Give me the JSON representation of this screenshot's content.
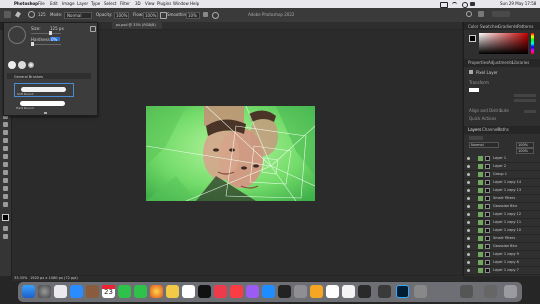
{
  "menu_bar": {
    "app_name": "Photoshop",
    "items": [
      "File",
      "Edit",
      "Image",
      "Layer",
      "Type",
      "Select",
      "Filter",
      "3D",
      "View",
      "Plugins",
      "Window",
      "Help"
    ],
    "clock": "Sun 29 May 17:58"
  },
  "options_bar": {
    "brush_size": "125",
    "mode_label": "Mode:",
    "mode_value": "Normal",
    "opacity_label": "Opacity:",
    "opacity_value": "100%",
    "flow_label": "Flow:",
    "flow_value": "100%",
    "smoothing_label": "Smoothing:",
    "smoothing_value": "10%"
  },
  "window": {
    "title": "Adobe Photoshop 2022",
    "document_tab": "ps.psd @ 33% (RGB/8)"
  },
  "brush_popup": {
    "size_label": "Size:",
    "size_value": "125 px",
    "hardness_label": "Hardness:",
    "hardness_value": "0%",
    "group_name": "General Brushes",
    "brushes": [
      "Soft Round",
      "Hard Round"
    ]
  },
  "right_panel": {
    "color_tabs": [
      "Color",
      "Swatches",
      "Gradients",
      "Patterns"
    ],
    "properties_tabs": [
      "Properties",
      "Adjustments",
      "Libraries"
    ],
    "properties_title": "Pixel Layer",
    "transform_label": "Transform",
    "align_label": "Align and Distribute",
    "quick_actions_label": "Quick Actions",
    "layers_tabs": [
      "Layers",
      "Channels",
      "Paths"
    ],
    "blend_mode": "Normal",
    "opacity_value": "100%",
    "fill_value": "100%",
    "layers": [
      {
        "name": "Layer 1"
      },
      {
        "name": "Layer 2"
      },
      {
        "name": "Group 1"
      },
      {
        "name": "Layer 1 copy 14"
      },
      {
        "name": "Layer 1 copy 13"
      },
      {
        "name": "Smart Filters"
      },
      {
        "name": "Gaussian Blur"
      },
      {
        "name": "Layer 1 copy 12"
      },
      {
        "name": "Layer 1 copy 11"
      },
      {
        "name": "Layer 1 copy 10"
      },
      {
        "name": "Smart Filters"
      },
      {
        "name": "Gaussian Blur"
      },
      {
        "name": "Layer 1 copy 9"
      },
      {
        "name": "Layer 1 copy 8"
      },
      {
        "name": "Layer 1 copy 7"
      },
      {
        "name": "Layer 1 copy 6"
      },
      {
        "name": "Layer 1 copy 5"
      },
      {
        "name": "Layer 1 copy 4"
      },
      {
        "name": "Layer 1 copy 3"
      }
    ]
  },
  "status_bar": {
    "zoom": "33.33%",
    "doc_size": "1920 px x 1080 px (72 ppi)"
  },
  "dock": {
    "date_day": "23",
    "date_month": "MAY"
  },
  "colors": {
    "foreground": "#000000",
    "background": "#ffffff",
    "canvas_green": "#7ee07a",
    "accent": "#0f6fff"
  }
}
